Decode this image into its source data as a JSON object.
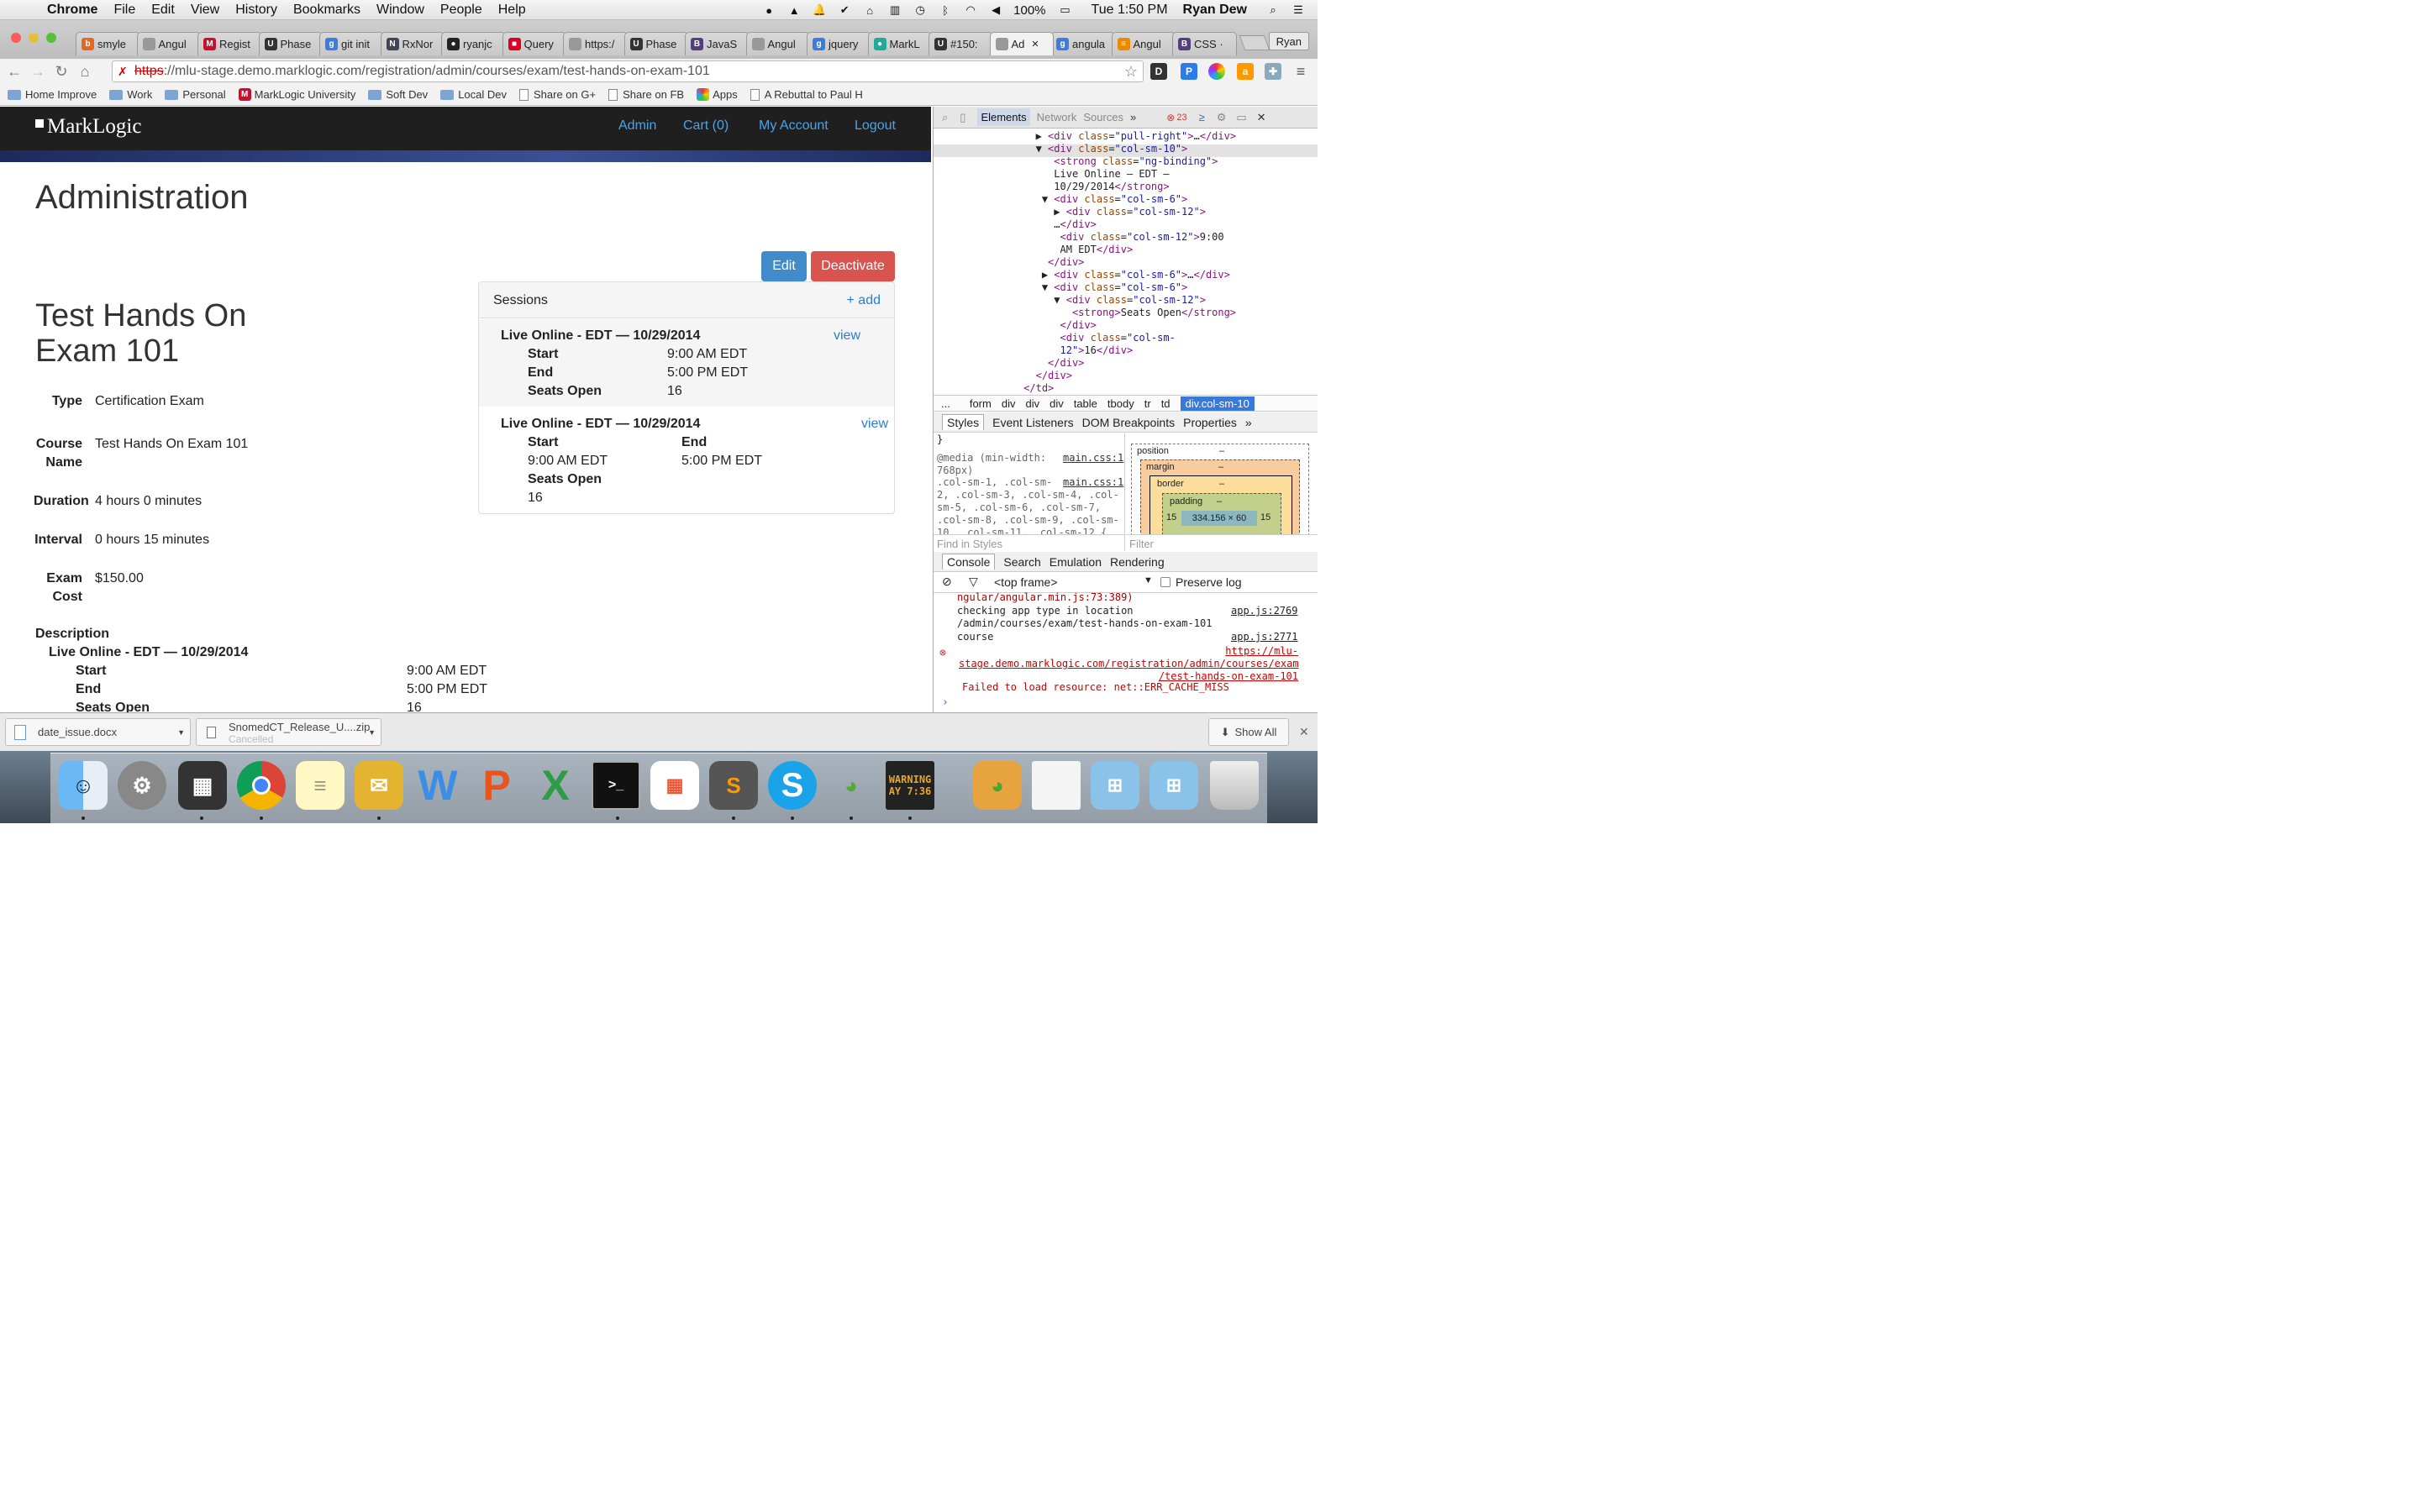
{
  "menubar": {
    "app": "Chrome",
    "items": [
      "File",
      "Edit",
      "View",
      "History",
      "Bookmarks",
      "Window",
      "People",
      "Help"
    ],
    "battery": "100%",
    "clock": "Tue 1:50 PM",
    "user": "Ryan Dew"
  },
  "tabs": [
    {
      "label": "smyle",
      "color": "#e8671f",
      "glyph": "b"
    },
    {
      "label": "Angul",
      "color": "#999",
      "glyph": ""
    },
    {
      "label": "Regist",
      "color": "#c8102e",
      "glyph": "M"
    },
    {
      "label": "Phase",
      "color": "#333",
      "glyph": "U"
    },
    {
      "label": "git init",
      "color": "#3b7ddd",
      "glyph": "g"
    },
    {
      "label": "RxNor",
      "color": "#445",
      "glyph": "N"
    },
    {
      "label": "ryanjc",
      "color": "#222",
      "glyph": "●"
    },
    {
      "label": "Query",
      "color": "#d02",
      "glyph": "■"
    },
    {
      "label": "https:/",
      "color": "#999",
      "glyph": ""
    },
    {
      "label": "Phase",
      "color": "#333",
      "glyph": "U"
    },
    {
      "label": "JavaS",
      "color": "#563d7c",
      "glyph": "B"
    },
    {
      "label": "Angul",
      "color": "#999",
      "glyph": ""
    },
    {
      "label": "jquery",
      "color": "#3b7ddd",
      "glyph": "g"
    },
    {
      "label": "MarkL",
      "color": "#2a9",
      "glyph": "●"
    },
    {
      "label": "#150:",
      "color": "#333",
      "glyph": "U"
    },
    {
      "label": "Ad",
      "color": "#999",
      "glyph": "",
      "active": true
    },
    {
      "label": "angula",
      "color": "#3b7ddd",
      "glyph": "g"
    },
    {
      "label": "Angul",
      "color": "#e80",
      "glyph": "≡"
    },
    {
      "label": "CSS ·",
      "color": "#563d7c",
      "glyph": "B"
    }
  ],
  "profile": "Ryan",
  "address": {
    "scheme": "https",
    "rest": "://mlu-stage.demo.marklogic.com/registration/admin/courses/exam/test-hands-on-exam-101"
  },
  "bookmarks": [
    {
      "label": "Home Improve",
      "type": "folder"
    },
    {
      "label": "Work",
      "type": "folder"
    },
    {
      "label": "Personal",
      "type": "folder"
    },
    {
      "label": "MarkLogic University",
      "type": "ml"
    },
    {
      "label": "Soft Dev",
      "type": "folder"
    },
    {
      "label": "Local Dev",
      "type": "folder"
    },
    {
      "label": "Share on G+",
      "type": "page"
    },
    {
      "label": "Share on FB",
      "type": "page"
    },
    {
      "label": "Apps",
      "type": "apps"
    },
    {
      "label": "A Rebuttal to Paul H",
      "type": "page"
    }
  ],
  "site": {
    "logo": "MarkLogic",
    "nav": [
      "Admin",
      "Cart (0)",
      "My Account",
      "Logout"
    ],
    "heading": "Administration",
    "edit": "Edit",
    "deactivate": "Deactivate",
    "course_title": "Test Hands On Exam 101",
    "fields": [
      {
        "label": "Type",
        "value": "Certification Exam"
      },
      {
        "label": "Course Name",
        "value": "Test Hands On Exam 101"
      },
      {
        "label": "Duration",
        "value": "4 hours 0 minutes"
      },
      {
        "label": "Interval",
        "value": "0 hours 15 minutes"
      },
      {
        "label": "Exam Cost",
        "value": "$150.00"
      }
    ],
    "description_label": "Description",
    "desc_session": {
      "title": "Live Online - EDT — 10/29/2014",
      "start_l": "Start",
      "start": "9:00 AM EDT",
      "end_l": "End",
      "end": "5:00 PM EDT",
      "seats_l": "Seats Open",
      "seats": "16"
    },
    "sessions_title": "Sessions",
    "add": "+ add",
    "session1": {
      "title": "Live Online - EDT — 10/29/2014",
      "view": "view",
      "start_l": "Start",
      "start": "9:00 AM EDT",
      "end_l": "End",
      "end": "5:00 PM EDT",
      "seats_l": "Seats Open",
      "seats": "16"
    },
    "session2": {
      "title": "Live Online - EDT — 10/29/2014",
      "view": "view",
      "start_l": "Start",
      "start": "9:00 AM EDT",
      "end_l": "End",
      "end": "5:00 PM EDT",
      "seats_l": "Seats Open",
      "seats": "16"
    }
  },
  "devtools": {
    "tabs": [
      "Elements",
      "Network",
      "Sources"
    ],
    "errors": "23",
    "crumbs": [
      "...",
      "form",
      "div",
      "div",
      "div",
      "table",
      "tbody",
      "tr",
      "td",
      "div.col-sm-10"
    ],
    "subtabs": [
      "Styles",
      "Event Listeners",
      "DOM Breakpoints",
      "Properties"
    ],
    "styles": {
      "brace": "}",
      "media": "@media (min-width:\n768px)",
      "file": "main.css:1",
      "rule": ".col-sm-1, .col-sm-\n2, .col-sm-3, .col-sm-4, .col-\nsm-5, .col-sm-6, .col-sm-7,\n.col-sm-8, .col-sm-9, .col-sm-\n10, .col-sm-11, .col-sm-12 {",
      "find": "Find in Styles",
      "filter": "Filter"
    },
    "boxmodel": {
      "position": "position",
      "margin": "margin",
      "border": "border",
      "padding": "padding",
      "dash": "–",
      "content": "334.156 × 60",
      "pad": "15"
    },
    "console_tabs": [
      "Console",
      "Search",
      "Emulation",
      "Rendering"
    ],
    "frame": "<top frame>",
    "preserve": "Preserve log",
    "console": [
      {
        "text": "ngular/angular.min.js:73:389)",
        "src": ""
      },
      {
        "text": "checking app type in location\n/admin/courses/exam/test-hands-on-exam-101",
        "src": "app.js:2769"
      },
      {
        "text": "course",
        "src": "app.js:2771"
      }
    ],
    "error_url": "https://mlu-\nstage.demo.marklogic.com/registration/admin/courses/exam\n/test-hands-on-exam-101",
    "error_msg": "Failed to load resource: net::ERR_CACHE_MISS"
  },
  "downloads": {
    "file1": "date_issue.docx",
    "file2": "SnomedCT_Release_U....zip",
    "file2_status": "Cancelled",
    "show_all": "Show All"
  },
  "dock_term": "WARNING\nAY 7:36"
}
